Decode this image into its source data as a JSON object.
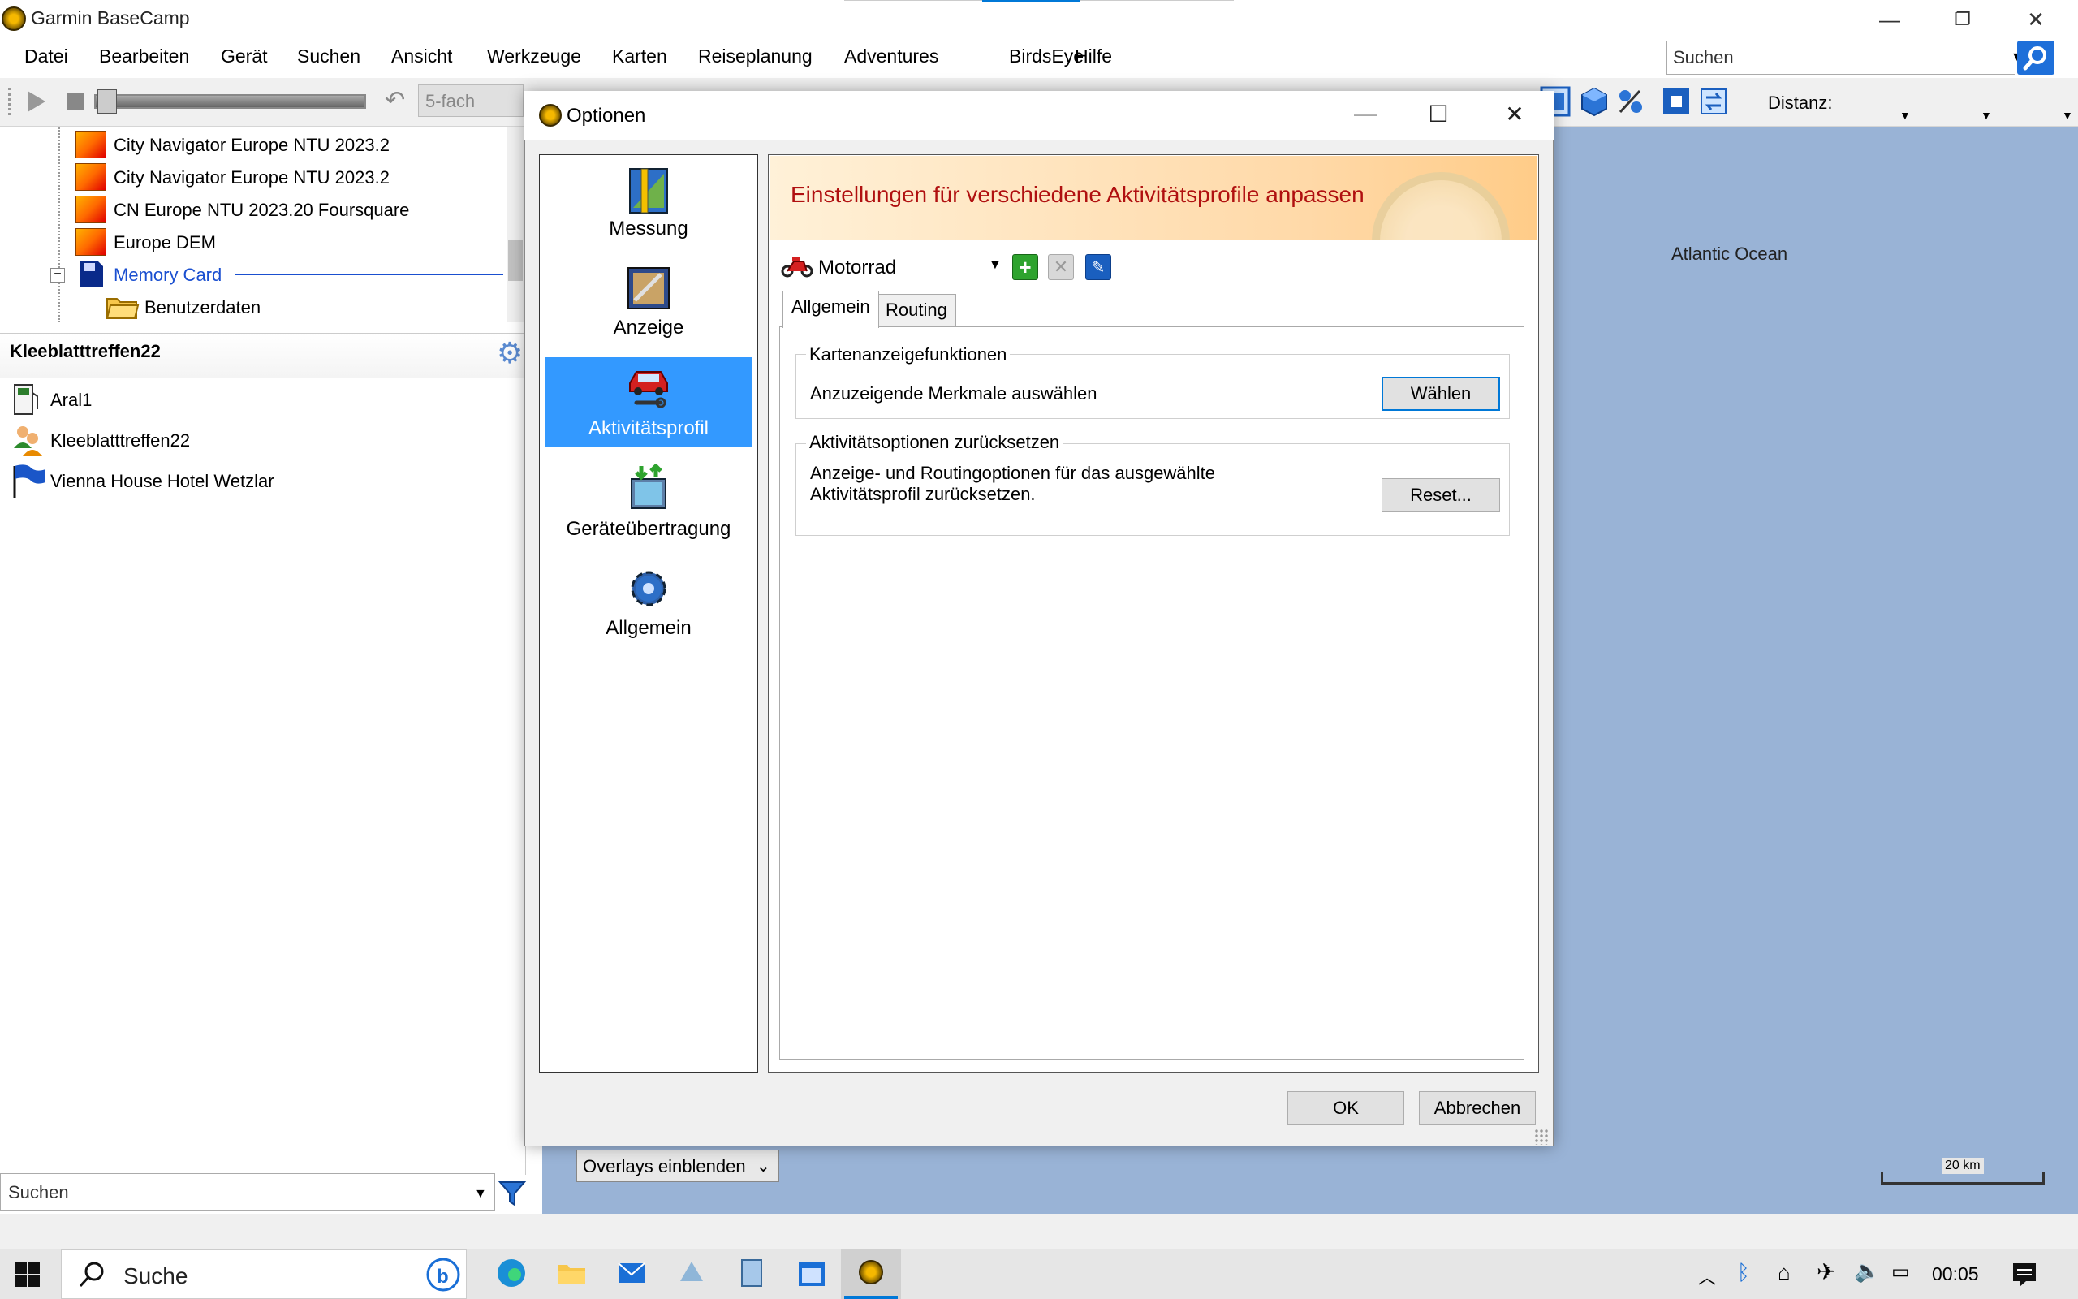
{
  "app": {
    "title": "Garmin BaseCamp",
    "minimize": "—",
    "restore": "❐",
    "close": "✕"
  },
  "menu": {
    "items": [
      "Datei",
      "Bearbeiten",
      "Gerät",
      "Suchen",
      "Ansicht",
      "Werkzeuge",
      "Karten",
      "Reiseplanung",
      "Adventures",
      "BirdsEye",
      "Hilfe"
    ],
    "search_value": "Suchen"
  },
  "toolbar": {
    "speed_value": "5-fach",
    "distance_label": "Distanz:"
  },
  "tree": {
    "items": [
      {
        "label": "City Navigator Europe NTU 2023.2",
        "icon": "map-product-icon"
      },
      {
        "label": "City Navigator Europe NTU 2023.2",
        "icon": "map-product-icon"
      },
      {
        "label": "CN Europe NTU 2023.20 Foursquare",
        "icon": "map-product-icon"
      },
      {
        "label": "Europe DEM",
        "icon": "map-product-icon"
      },
      {
        "label": "Memory Card",
        "icon": "memory-card-icon"
      },
      {
        "label": "Benutzerdaten",
        "icon": "folder-icon"
      }
    ],
    "expander": "−"
  },
  "list": {
    "title": "Kleeblatttreffen22",
    "items": [
      {
        "label": "Aral1",
        "icon": "fuel-station-icon"
      },
      {
        "label": "Kleeblatttreffen22",
        "icon": "group-icon"
      },
      {
        "label": "Vienna House Hotel Wetzlar",
        "icon": "flag-icon"
      }
    ],
    "search_value": "Suchen"
  },
  "map": {
    "label": "Atlantic Ocean",
    "scale": "20 km",
    "overlay_select": "Overlays einblenden"
  },
  "taskbar": {
    "search_text": "Suche",
    "clock": "00:05"
  },
  "dialog": {
    "title": "Optionen",
    "nav": [
      {
        "label": "Messung",
        "icon": "ruler-icon",
        "active": false
      },
      {
        "label": "Anzeige",
        "icon": "display-icon",
        "active": false
      },
      {
        "label": "Aktivitätsprofil",
        "icon": "car-wrench-icon",
        "active": true
      },
      {
        "label": "Geräteübertragung",
        "icon": "device-transfer-icon",
        "active": false
      },
      {
        "label": "Allgemein",
        "icon": "gear-icon",
        "active": false
      }
    ],
    "banner": "Einstellungen für verschiedene Aktivitätsprofile anpassen",
    "profile_value": "Motorrad",
    "tabs": [
      "Allgemein",
      "Routing"
    ],
    "group1": {
      "title": "Kartenanzeigefunktionen",
      "text": "Anzuzeigende Merkmale auswählen",
      "button": "Wählen"
    },
    "group2": {
      "title": "Aktivitätsoptionen zurücksetzen",
      "text_line1": "Anzeige- und Routingoptionen für das ausgewählte",
      "text_line2": "Aktivitätsprofil zurücksetzen.",
      "button": "Reset..."
    },
    "ok": "OK",
    "cancel": "Abbrechen",
    "minimize": "—",
    "maximize": "☐",
    "close": "✕"
  },
  "colors": {
    "accent": "#3399ff",
    "banner_text": "#b01010",
    "map_water": "#99b3d6"
  }
}
